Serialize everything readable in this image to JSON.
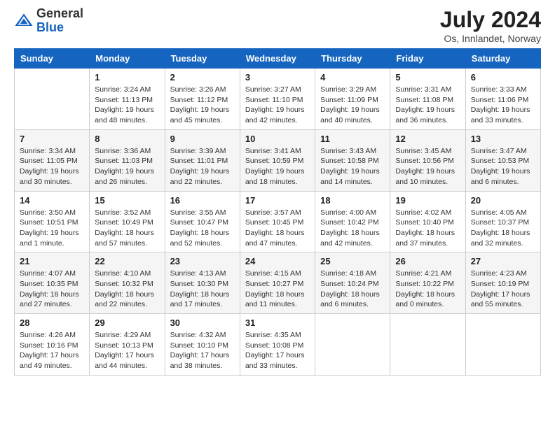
{
  "header": {
    "logo": {
      "general": "General",
      "blue": "Blue"
    },
    "title": "July 2024",
    "subtitle": "Os, Innlandet, Norway"
  },
  "calendar": {
    "weekdays": [
      "Sunday",
      "Monday",
      "Tuesday",
      "Wednesday",
      "Thursday",
      "Friday",
      "Saturday"
    ],
    "weeks": [
      [
        {
          "day": "",
          "info": ""
        },
        {
          "day": "1",
          "info": "Sunrise: 3:24 AM\nSunset: 11:13 PM\nDaylight: 19 hours\nand 48 minutes."
        },
        {
          "day": "2",
          "info": "Sunrise: 3:26 AM\nSunset: 11:12 PM\nDaylight: 19 hours\nand 45 minutes."
        },
        {
          "day": "3",
          "info": "Sunrise: 3:27 AM\nSunset: 11:10 PM\nDaylight: 19 hours\nand 42 minutes."
        },
        {
          "day": "4",
          "info": "Sunrise: 3:29 AM\nSunset: 11:09 PM\nDaylight: 19 hours\nand 40 minutes."
        },
        {
          "day": "5",
          "info": "Sunrise: 3:31 AM\nSunset: 11:08 PM\nDaylight: 19 hours\nand 36 minutes."
        },
        {
          "day": "6",
          "info": "Sunrise: 3:33 AM\nSunset: 11:06 PM\nDaylight: 19 hours\nand 33 minutes."
        }
      ],
      [
        {
          "day": "7",
          "info": "Sunrise: 3:34 AM\nSunset: 11:05 PM\nDaylight: 19 hours\nand 30 minutes."
        },
        {
          "day": "8",
          "info": "Sunrise: 3:36 AM\nSunset: 11:03 PM\nDaylight: 19 hours\nand 26 minutes."
        },
        {
          "day": "9",
          "info": "Sunrise: 3:39 AM\nSunset: 11:01 PM\nDaylight: 19 hours\nand 22 minutes."
        },
        {
          "day": "10",
          "info": "Sunrise: 3:41 AM\nSunset: 10:59 PM\nDaylight: 19 hours\nand 18 minutes."
        },
        {
          "day": "11",
          "info": "Sunrise: 3:43 AM\nSunset: 10:58 PM\nDaylight: 19 hours\nand 14 minutes."
        },
        {
          "day": "12",
          "info": "Sunrise: 3:45 AM\nSunset: 10:56 PM\nDaylight: 19 hours\nand 10 minutes."
        },
        {
          "day": "13",
          "info": "Sunrise: 3:47 AM\nSunset: 10:53 PM\nDaylight: 19 hours\nand 6 minutes."
        }
      ],
      [
        {
          "day": "14",
          "info": "Sunrise: 3:50 AM\nSunset: 10:51 PM\nDaylight: 19 hours\nand 1 minute."
        },
        {
          "day": "15",
          "info": "Sunrise: 3:52 AM\nSunset: 10:49 PM\nDaylight: 18 hours\nand 57 minutes."
        },
        {
          "day": "16",
          "info": "Sunrise: 3:55 AM\nSunset: 10:47 PM\nDaylight: 18 hours\nand 52 minutes."
        },
        {
          "day": "17",
          "info": "Sunrise: 3:57 AM\nSunset: 10:45 PM\nDaylight: 18 hours\nand 47 minutes."
        },
        {
          "day": "18",
          "info": "Sunrise: 4:00 AM\nSunset: 10:42 PM\nDaylight: 18 hours\nand 42 minutes."
        },
        {
          "day": "19",
          "info": "Sunrise: 4:02 AM\nSunset: 10:40 PM\nDaylight: 18 hours\nand 37 minutes."
        },
        {
          "day": "20",
          "info": "Sunrise: 4:05 AM\nSunset: 10:37 PM\nDaylight: 18 hours\nand 32 minutes."
        }
      ],
      [
        {
          "day": "21",
          "info": "Sunrise: 4:07 AM\nSunset: 10:35 PM\nDaylight: 18 hours\nand 27 minutes."
        },
        {
          "day": "22",
          "info": "Sunrise: 4:10 AM\nSunset: 10:32 PM\nDaylight: 18 hours\nand 22 minutes."
        },
        {
          "day": "23",
          "info": "Sunrise: 4:13 AM\nSunset: 10:30 PM\nDaylight: 18 hours\nand 17 minutes."
        },
        {
          "day": "24",
          "info": "Sunrise: 4:15 AM\nSunset: 10:27 PM\nDaylight: 18 hours\nand 11 minutes."
        },
        {
          "day": "25",
          "info": "Sunrise: 4:18 AM\nSunset: 10:24 PM\nDaylight: 18 hours\nand 6 minutes."
        },
        {
          "day": "26",
          "info": "Sunrise: 4:21 AM\nSunset: 10:22 PM\nDaylight: 18 hours\nand 0 minutes."
        },
        {
          "day": "27",
          "info": "Sunrise: 4:23 AM\nSunset: 10:19 PM\nDaylight: 17 hours\nand 55 minutes."
        }
      ],
      [
        {
          "day": "28",
          "info": "Sunrise: 4:26 AM\nSunset: 10:16 PM\nDaylight: 17 hours\nand 49 minutes."
        },
        {
          "day": "29",
          "info": "Sunrise: 4:29 AM\nSunset: 10:13 PM\nDaylight: 17 hours\nand 44 minutes."
        },
        {
          "day": "30",
          "info": "Sunrise: 4:32 AM\nSunset: 10:10 PM\nDaylight: 17 hours\nand 38 minutes."
        },
        {
          "day": "31",
          "info": "Sunrise: 4:35 AM\nSunset: 10:08 PM\nDaylight: 17 hours\nand 33 minutes."
        },
        {
          "day": "",
          "info": ""
        },
        {
          "day": "",
          "info": ""
        },
        {
          "day": "",
          "info": ""
        }
      ]
    ]
  }
}
